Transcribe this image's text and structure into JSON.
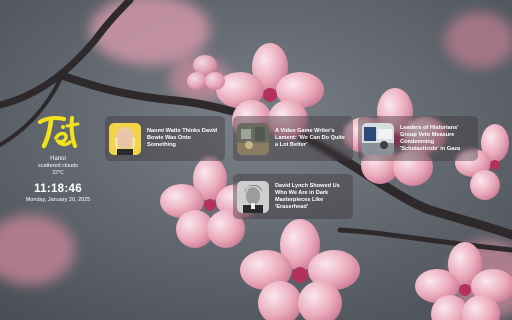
{
  "weather_widget": {
    "city": "Hanoi",
    "condition": "scattered clouds",
    "temperature": "22°C"
  },
  "clock": {
    "time": "11:18:46",
    "date": "Monday, January 20, 2025"
  },
  "news": [
    {
      "headline": "Naomi Watts Thinks David Bowie Was Onto Something",
      "thumbnail": "portrait-blonde-woman"
    },
    {
      "headline": "A Video Game Writer's Lament: 'We Can Do Quite a Lot Better'",
      "thumbnail": "room-scene"
    },
    {
      "headline": "Leaders of Historians' Group Veto Measure Condemning 'Scholasticide' in Gaza",
      "thumbnail": "office-scene"
    },
    {
      "headline": "David Lynch Showed Us Who We Are in Dark Masterpieces Like 'Eraserhead'",
      "thumbnail": "bw-portrait-man"
    }
  ],
  "colors": {
    "logo_yellow": "#f2e21b",
    "blossom_pink": "#e9a7b7",
    "branch_dark": "#2f2a2c"
  }
}
